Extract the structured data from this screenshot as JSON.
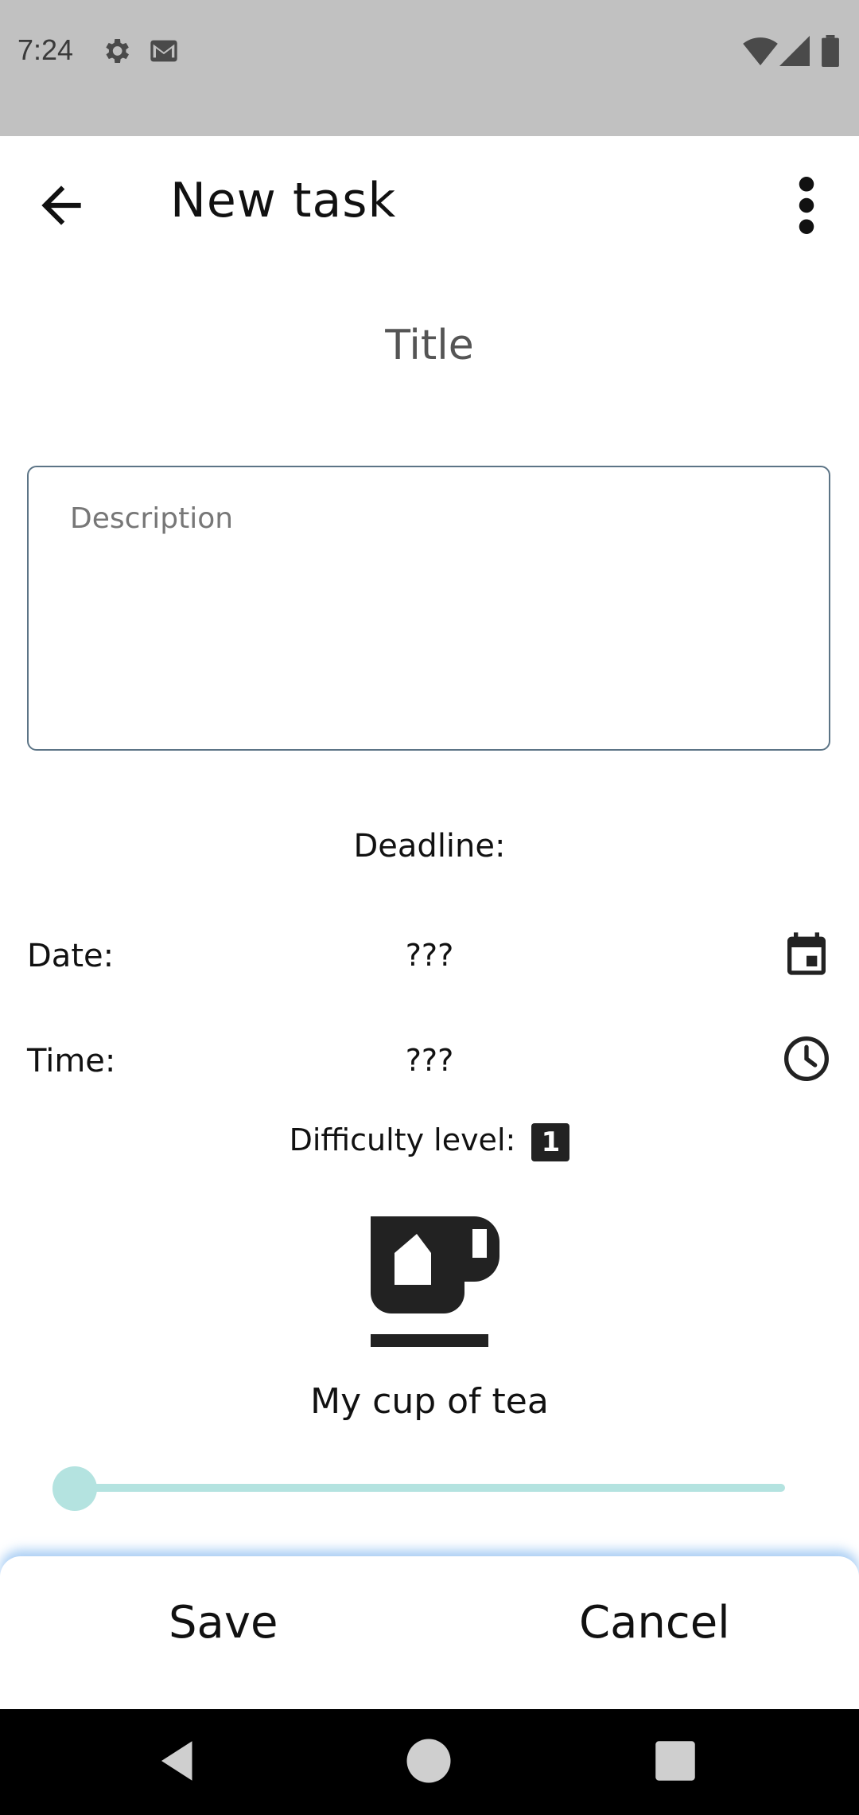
{
  "status_bar": {
    "time": "7:24",
    "left_icons": [
      "gear-icon",
      "gmail-icon"
    ],
    "right_icons": [
      "wifi-icon",
      "signal-icon",
      "battery-icon"
    ]
  },
  "app_bar": {
    "title": "New task",
    "back_icon": "arrow-back-icon",
    "menu_icon": "more-vert-icon"
  },
  "form": {
    "title_placeholder": "Title",
    "description_placeholder": "Description",
    "deadline_label": "Deadline:",
    "date_label": "Date:",
    "date_value": "???",
    "time_label": "Time:",
    "time_value": "???",
    "difficulty_label": "Difficulty level:",
    "difficulty_value": "1",
    "difficulty_caption": "My cup of tea",
    "difficulty_slider_fraction": 0.0
  },
  "actions": {
    "save_label": "Save",
    "cancel_label": "Cancel"
  },
  "colors": {
    "status_bar": "#c1c1c1",
    "slider": "#b4e3e0",
    "box_border": "#5c7486"
  }
}
